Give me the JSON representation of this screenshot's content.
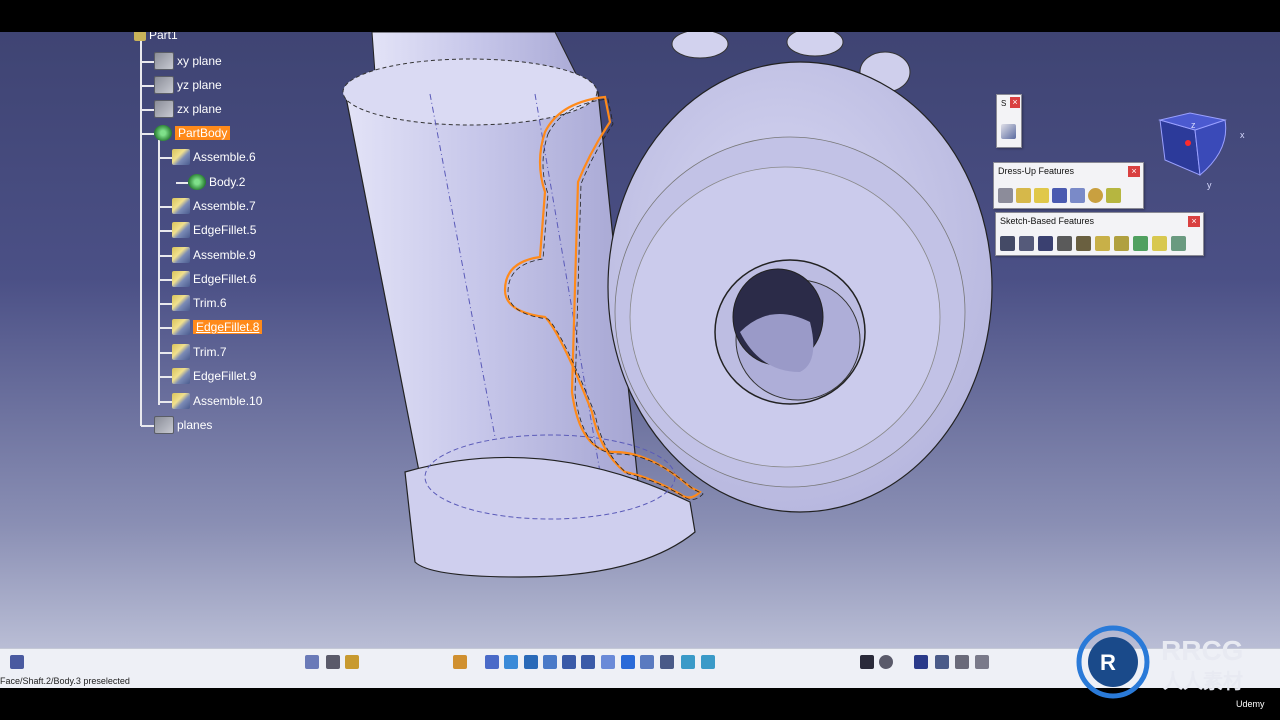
{
  "tree": {
    "root": "Part1",
    "items": [
      {
        "label": "xy plane",
        "kind": "plane"
      },
      {
        "label": "yz plane",
        "kind": "plane"
      },
      {
        "label": "zx plane",
        "kind": "plane"
      },
      {
        "label": "PartBody",
        "kind": "body",
        "highlight": true
      },
      {
        "label": "Assemble.6",
        "kind": "feat"
      },
      {
        "label": "Body.2",
        "kind": "body"
      },
      {
        "label": "Assemble.7",
        "kind": "feat"
      },
      {
        "label": "EdgeFillet.5",
        "kind": "feat"
      },
      {
        "label": "Assemble.9",
        "kind": "feat"
      },
      {
        "label": "EdgeFillet.6",
        "kind": "feat"
      },
      {
        "label": "Trim.6",
        "kind": "feat"
      },
      {
        "label": "EdgeFillet.8",
        "kind": "feat",
        "highlight": true
      },
      {
        "label": "Trim.7",
        "kind": "feat"
      },
      {
        "label": "EdgeFillet.9",
        "kind": "feat"
      },
      {
        "label": "Assemble.10",
        "kind": "feat"
      },
      {
        "label": "planes",
        "kind": "plane"
      }
    ]
  },
  "toolbars": {
    "small_title": "S",
    "dressup_title": "Dress-Up Features",
    "sketch_title": "Sketch-Based Features",
    "close_symbol": "×"
  },
  "compass": {
    "x_label": "x",
    "y_label": "y",
    "z_label": "z"
  },
  "status": {
    "text": "Face/Shaft.2/Body.3 preselected"
  },
  "watermark": {
    "brand": "RRCG",
    "sub": "人人素材",
    "udemy": "Udemy"
  },
  "colors": {
    "highlight": "#ff8a1a",
    "model": "#c9c9ee",
    "background_top": "#3f4473"
  }
}
